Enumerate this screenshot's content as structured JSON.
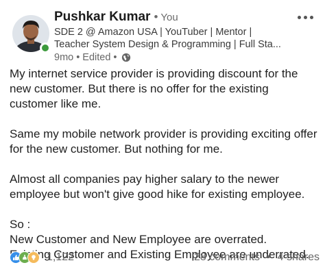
{
  "author": {
    "name": "Pushkar Kumar",
    "degree": "You",
    "headline_lines": [
      "SDE 2 @ Amazon USA | YouTuber | Mentor |",
      "Teacher System Design & Programming | Full Sta..."
    ],
    "time": "9mo",
    "edited": "Edited",
    "visibility_icon": "globe-icon",
    "presence": "online"
  },
  "post": {
    "paragraphs": [
      [
        "My internet service provider is providing discount for the",
        "new customer. But there is no offer for the existing",
        "customer like me."
      ],
      [
        "Same my mobile network provider is providing exciting offer",
        "for the new customer. But nothing for me."
      ],
      [
        "Almost all companies pay higher salary to the newer",
        "employee but won't give good hike for existing employee."
      ],
      [
        "So :",
        "New Customer and New Employee are overrated.",
        "Existing Customer and Existing Employee are underrated."
      ]
    ]
  },
  "social": {
    "reaction_icons": [
      "like-icon",
      "celebrate-icon",
      "insightful-icon"
    ],
    "reaction_count": "1,122",
    "comments": "28 comments",
    "shares": "4 shares"
  },
  "colors": {
    "presence": "#3c9a3c",
    "like": "#378fe9",
    "celebrate": "#6dae4f",
    "insightful": "#f5bb5c"
  }
}
